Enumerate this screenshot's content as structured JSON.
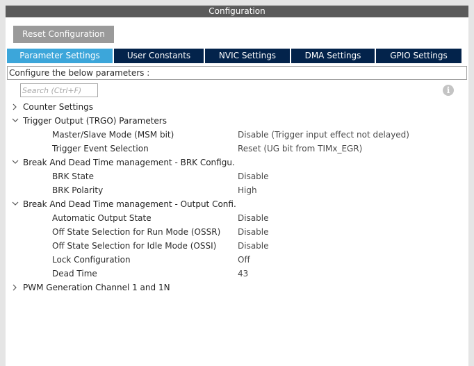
{
  "window": {
    "title": "Configuration"
  },
  "toolbar": {
    "reset_label": "Reset Configuration"
  },
  "tabs": [
    {
      "label": "Parameter Settings",
      "active": true
    },
    {
      "label": "User Constants",
      "active": false
    },
    {
      "label": "NVIC Settings",
      "active": false
    },
    {
      "label": "DMA Settings",
      "active": false
    },
    {
      "label": "GPIO Settings",
      "active": false
    }
  ],
  "info": {
    "text": "Configure the below parameters :"
  },
  "search": {
    "placeholder": "Search (Ctrl+F)"
  },
  "info_icon": {
    "glyph": "i",
    "icon": "info-icon"
  },
  "groups": [
    {
      "label": "Counter Settings",
      "expanded": false,
      "params": []
    },
    {
      "label": "Trigger Output (TRGO) Parameters",
      "expanded": true,
      "params": [
        {
          "label": "Master/Slave Mode (MSM bit)",
          "value": "Disable (Trigger input effect not delayed)"
        },
        {
          "label": "Trigger Event Selection",
          "value": "Reset (UG bit from TIMx_EGR)"
        }
      ]
    },
    {
      "label": "Break And Dead Time management - BRK Configu...",
      "expanded": true,
      "params": [
        {
          "label": "BRK State",
          "value": "Disable"
        },
        {
          "label": "BRK Polarity",
          "value": "High"
        }
      ]
    },
    {
      "label": "Break And Dead Time management - Output Confi...",
      "expanded": true,
      "params": [
        {
          "label": "Automatic Output State",
          "value": "Disable"
        },
        {
          "label": "Off State Selection for Run Mode (OSSR)",
          "value": "Disable"
        },
        {
          "label": "Off State Selection for Idle Mode (OSSI)",
          "value": "Disable"
        },
        {
          "label": "Lock Configuration",
          "value": "Off"
        },
        {
          "label": "Dead Time",
          "value": "43"
        }
      ]
    },
    {
      "label": "PWM Generation Channel 1 and 1N",
      "expanded": false,
      "params": []
    }
  ],
  "colors": {
    "title_bar": "#5b5b5b",
    "tab_bar": "#03234b",
    "tab_active": "#3ca6da",
    "reset_button": "#9a9a9a",
    "frame": "#e5e5e5"
  }
}
